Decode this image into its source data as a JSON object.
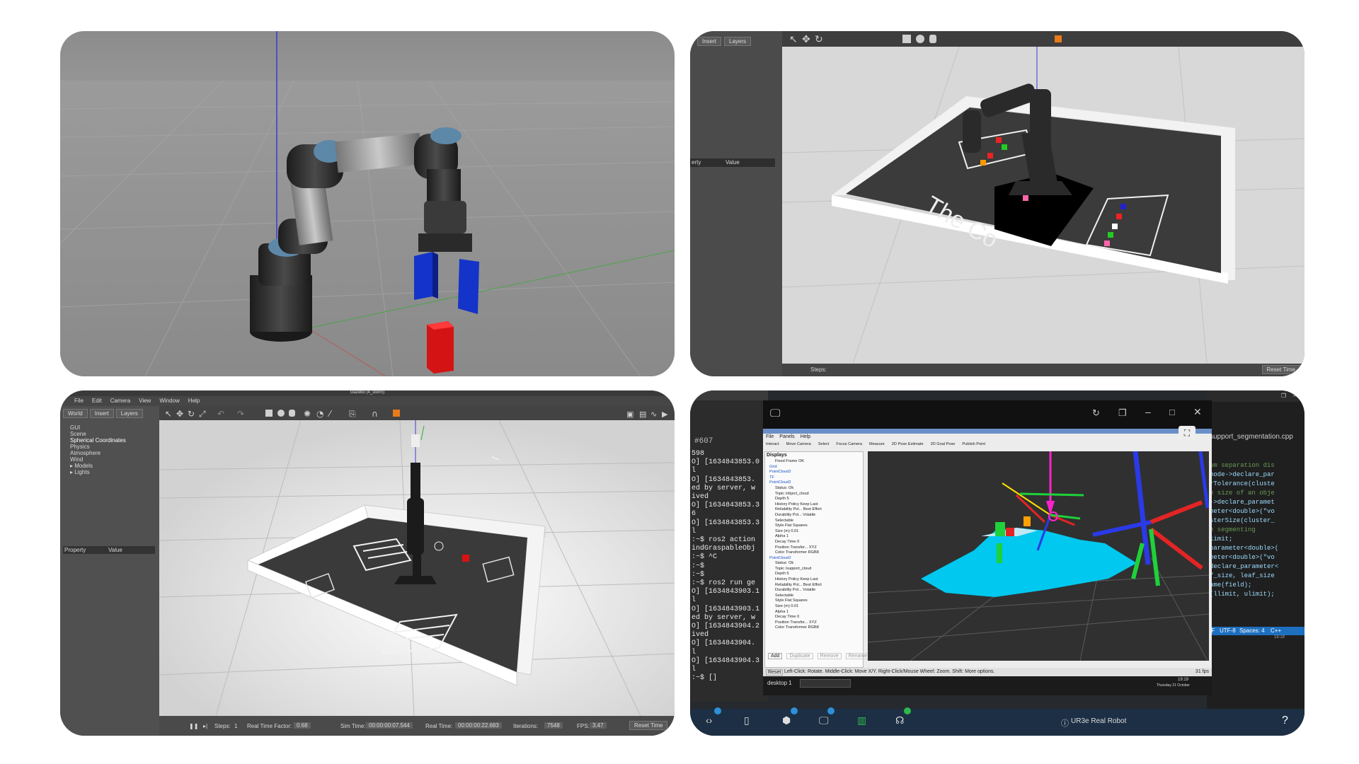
{
  "panel_bottom_left": {
    "window_title": "Gazebo (4_storm)",
    "menu": [
      "File",
      "Edit",
      "Camera",
      "View",
      "Window",
      "Help"
    ],
    "tabs": [
      "World",
      "Insert",
      "Layers"
    ],
    "tree": [
      "GUI",
      "Scene",
      "Spherical Coordinates",
      "Physics",
      "Atmosphere",
      "Wind",
      "▸ Models",
      "▸ Lights"
    ],
    "property_header": "Property",
    "value_header": "Value",
    "status": {
      "steps_label": "Steps:",
      "steps_value": "1",
      "rtf_label": "Real Time Factor:",
      "rtf_value": "0.68",
      "sim_time_label": "Sim Time:",
      "sim_time_value": "00:00:00:07.544",
      "real_time_label": "Real Time:",
      "real_time_value": "00:00:00:22.683",
      "iterations_label": "Iterations:",
      "iterations_value": "7548",
      "fps_label": "FPS:",
      "fps_value": "3.47",
      "reset_label": "Reset Time"
    }
  },
  "panel_top_right": {
    "tabs": [
      "Insert",
      "Layers"
    ],
    "property_header": "erty",
    "value_header": "Value",
    "reset_label": "Reset Time",
    "floor_text": "The Co"
  },
  "panel_bottom_right": {
    "terminal_tab": "#607",
    "terminal_lines": [
      "598",
      "O] [1634843853.0",
      "l",
      "O] [1634843853.",
      "ed by server, w",
      "ived",
      "O] [1634843853.3",
      "6",
      "O] [1634843853.3",
      "l",
      ":~$ ros2 action",
      "indGraspableObj",
      ":~$ ^C",
      ":~$",
      ":~$",
      ":~$ ros2 run ge",
      "O] [1634843903.1",
      "l",
      "O] [1634843903.1",
      "ed by server, w",
      "O] [1634843904.2",
      "ived",
      "O] [1634843904.",
      "l",
      "O] [1634843904.3",
      "l",
      ":~$ []"
    ],
    "rviz": {
      "menu": [
        "File",
        "Panels",
        "Help"
      ],
      "toolbar": [
        "Interact",
        "Move Camera",
        "Select",
        "Focus Camera",
        "Measure",
        "2D Pose Estimate",
        "2D Goal Pose",
        "Publish Point"
      ],
      "displays_title": "Displays",
      "displays": [
        "Fixed Frame   OK",
        "Grid",
        "PointCloud2",
        "TF",
        "PointCloud2",
        "Status: Ok",
        "Topic   /object_cloud",
        "Depth   5",
        "History Policy   Keep Last",
        "Reliability Pol...   Best Effort",
        "Durability Pol...   Volatile",
        "Selectable",
        "Style   Flat Squares",
        "Size (m)   0.01",
        "Alpha   1",
        "Decay Time   0",
        "Position Transfor...   XYZ",
        "Color Transformer   RGB8",
        "PointCloud2",
        "Status: Ok",
        "Topic   /support_cloud",
        "Depth   5",
        "History Policy   Keep Last",
        "Reliability Pol...   Best Effort",
        "Durability Pol...   Volatile",
        "Selectable",
        "Style   Flat Squares",
        "Size (m)   0.01",
        "Alpha   1",
        "Decay Time   0",
        "Position Transfor...   XYZ",
        "Color Transformer   RGB8"
      ],
      "panel_buttons": [
        "Add",
        "Duplicate",
        "Remove",
        "Rename"
      ],
      "status_reset": "Reset",
      "status_hint": "Left-Click: Rotate. Middle-Click: Move X/Y. Right-Click/Mouse Wheel: Zoom. Shift: More options.",
      "fps": "31 fps"
    },
    "taskbar_desktop": "desktop 1",
    "editor_tab": "support_segmentation.cpp",
    "code_lines": [
      "um separation dis",
      "node->declare_par",
      "rTolerance(cluste",
      "",
      "e size of an obje",
      "->declare_paramet",
      "meter<double>(\"vo",
      "sterSize(cluster_",
      "",
      "e segmenting",
      "limit;",
      "parameter<double>(",
      "meter<double>(\"vo",
      "declare_parameter<",
      "f_size, leaf_size",
      "ame(field);",
      "(llimit, ulimit);"
    ],
    "editor_status": [
      "LF",
      "UTF-8",
      "Spaces: 4",
      "C++"
    ],
    "clock_time": "19:19",
    "clock_date": "Thursday 21 October",
    "bottom_label": "UR3e Real Robot",
    "help": "?",
    "badge_color": "#2f8fd8",
    "badge_green": "#2eb84b"
  }
}
